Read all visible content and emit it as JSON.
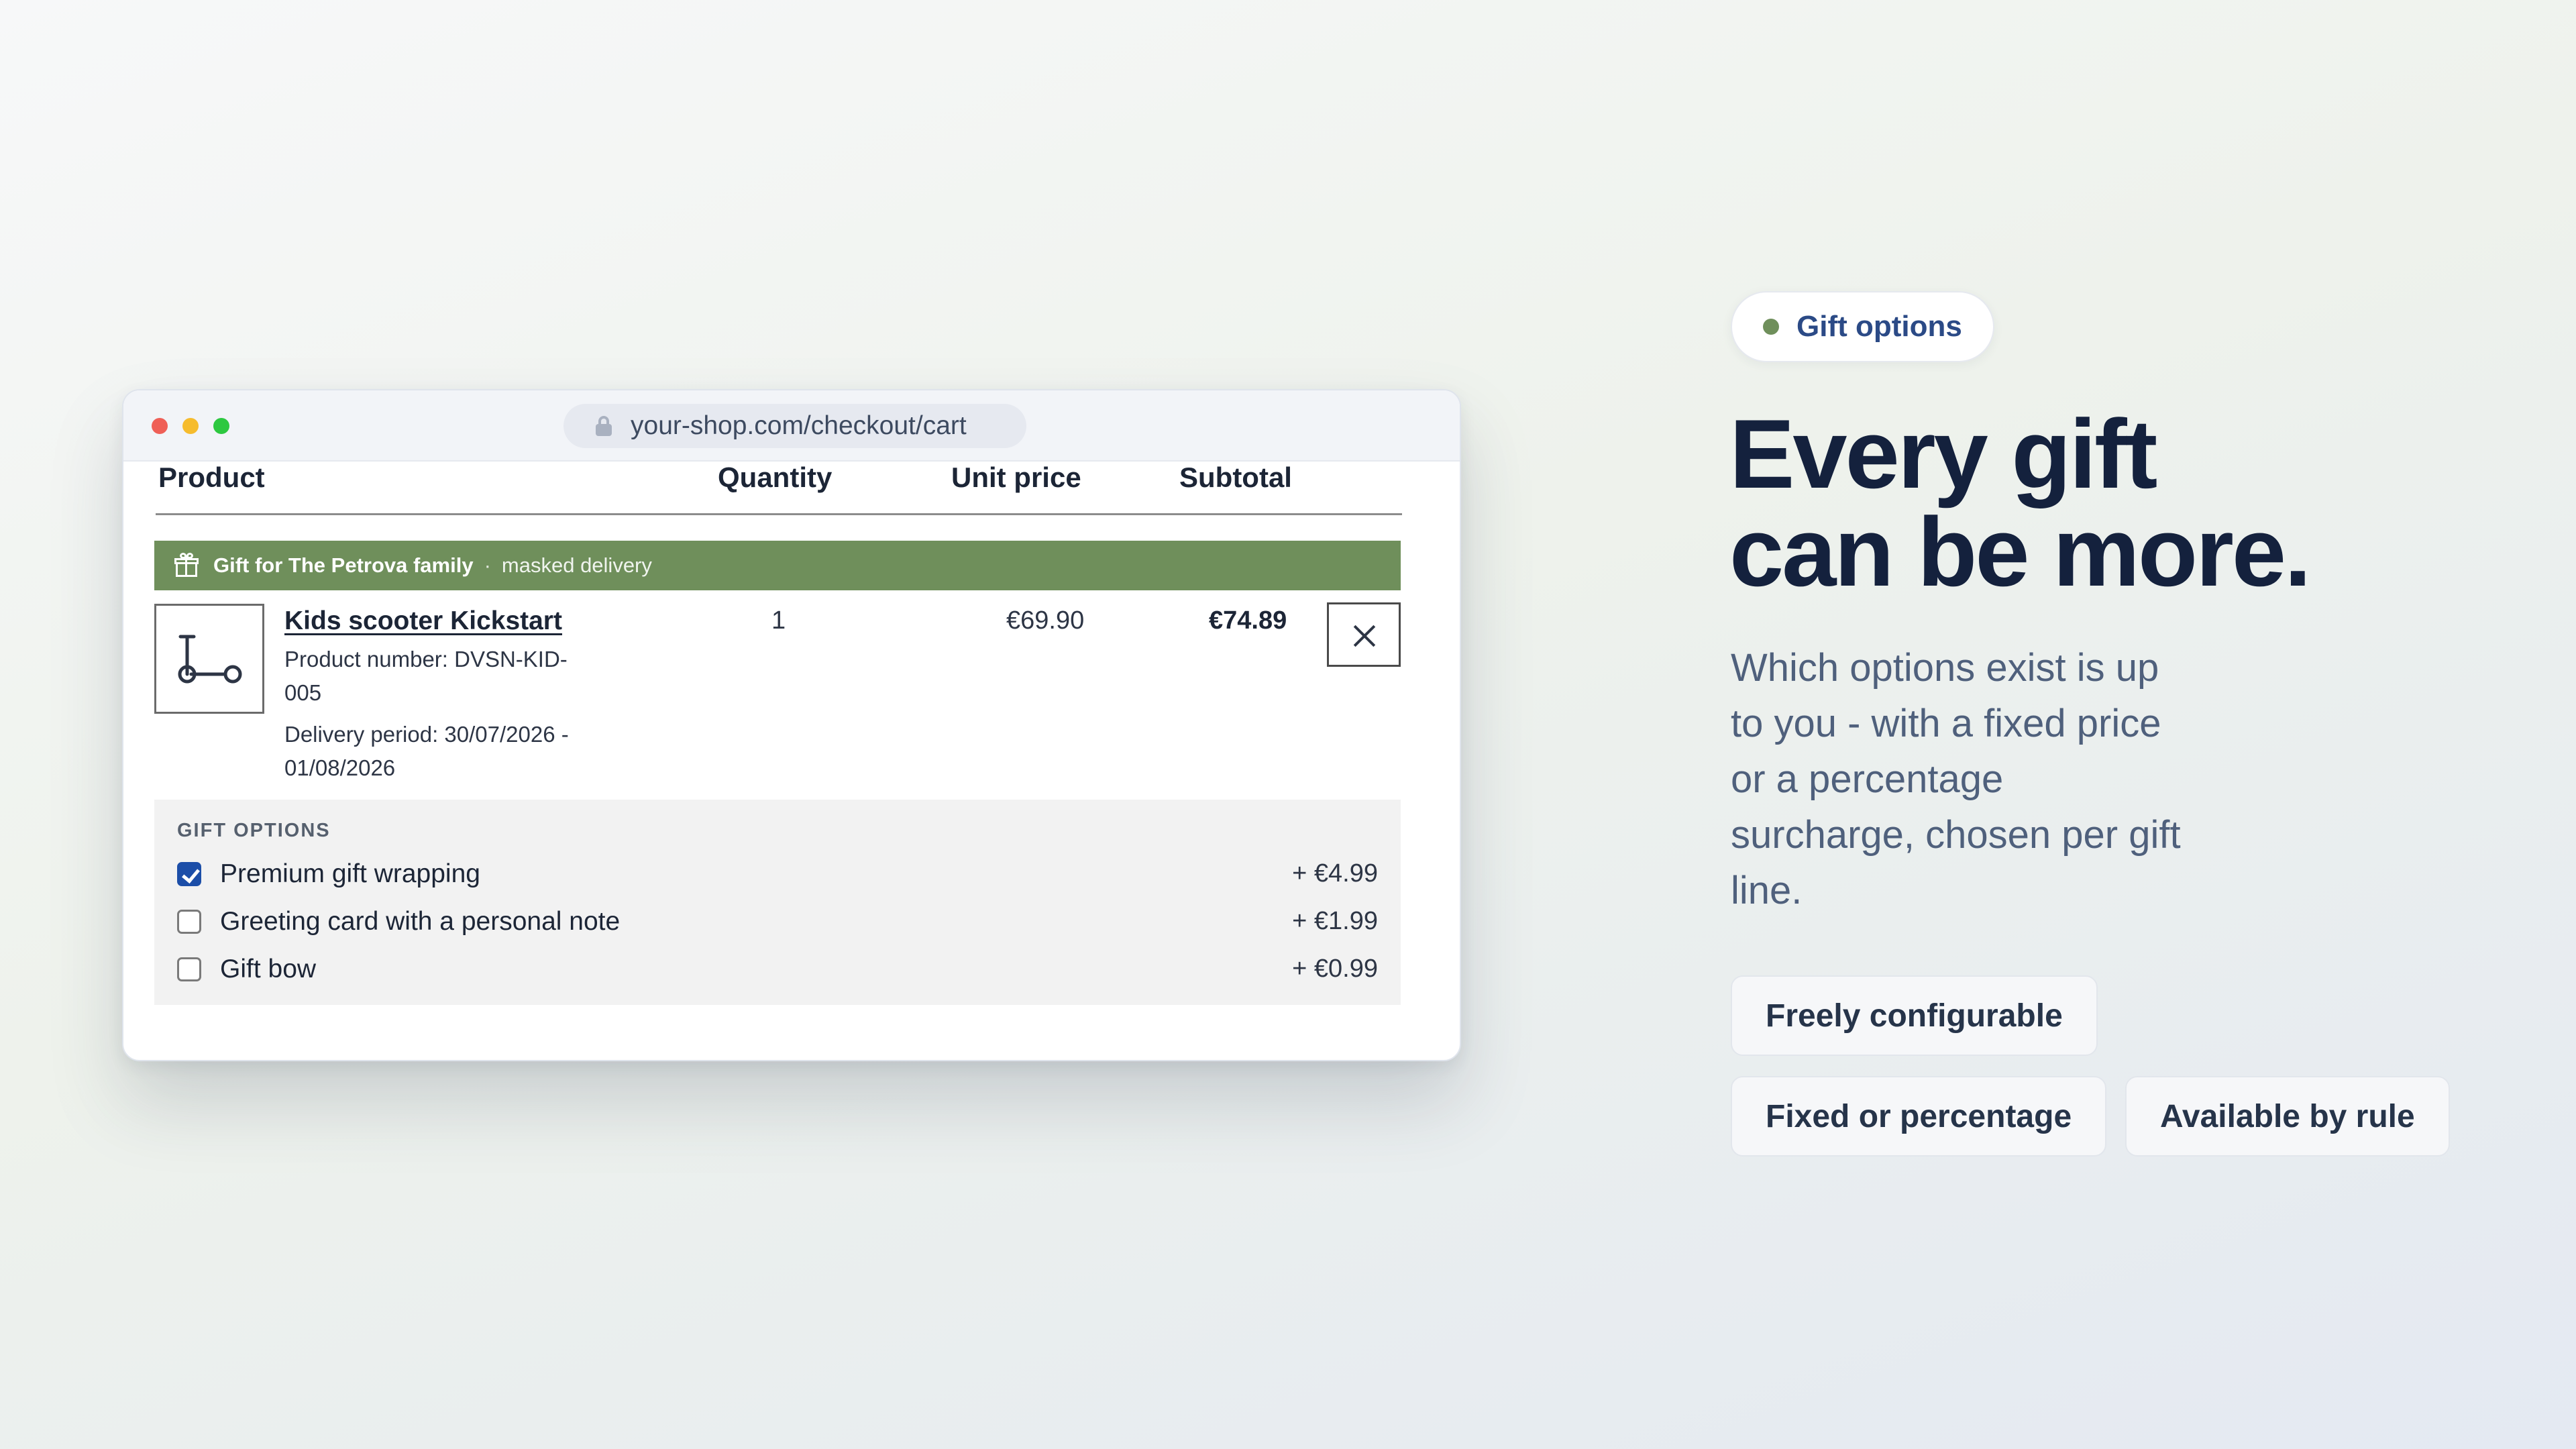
{
  "browser": {
    "url": "your-shop.com/checkout/cart"
  },
  "cart": {
    "columns": {
      "product": "Product",
      "quantity": "Quantity",
      "unit_price": "Unit price",
      "subtotal": "Subtotal"
    },
    "gift_banner": {
      "recipient": "Gift for The Petrova family",
      "separator": "·",
      "delivery": "masked delivery"
    },
    "item": {
      "name": "Kids scooter Kickstart",
      "product_number_line1": "Product number: DVSN-KID-",
      "product_number_line2": "005",
      "delivery_line1": "Delivery period: 30/07/2026 -",
      "delivery_line2": "01/08/2026",
      "quantity": "1",
      "unit_price": "€69.90",
      "subtotal": "€74.89",
      "icon": "scooter-icon"
    },
    "gift_options": {
      "title": "GIFT OPTIONS",
      "options": [
        {
          "label": "Premium gift wrapping",
          "price": "+ €4.99",
          "checked": true
        },
        {
          "label": "Greeting card with a personal note",
          "price": "+ €1.99",
          "checked": false
        },
        {
          "label": "Gift bow",
          "price": "+ €0.99",
          "checked": false
        }
      ]
    }
  },
  "promo": {
    "pill": "Gift options",
    "headline_line1": "Every gift",
    "headline_line2": "can be more.",
    "description_lines": [
      "Which options exist is up",
      "to you - with a fixed price",
      "or a percentage",
      "surcharge, chosen per gift",
      "line."
    ],
    "chips": [
      "Freely configurable",
      "Fixed or percentage",
      "Available by rule"
    ]
  },
  "colors": {
    "accent_green": "#6f8f5b",
    "checkbox_blue": "#1c4ea8",
    "headline_navy": "#14213d",
    "pill_text_blue": "#2b4a86"
  }
}
